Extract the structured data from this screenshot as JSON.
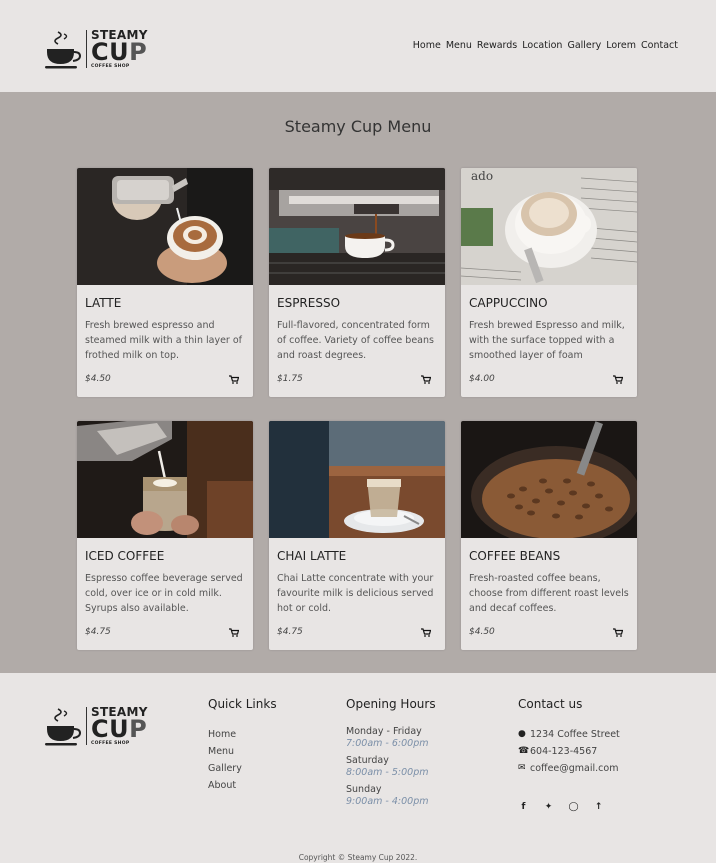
{
  "header": {
    "logo": {
      "top": "STEAMY",
      "mid_a": "CU",
      "mid_b": "P",
      "sub": "COFFEE SHOP"
    },
    "nav": [
      "Home",
      "Menu",
      "Rewards",
      "Location",
      "Gallery",
      "Lorem",
      "Contact"
    ]
  },
  "main": {
    "title": "Steamy Cup Menu",
    "items": [
      {
        "name": "LATTE",
        "desc": "Fresh brewed espresso and steamed milk with a thin layer of frothed milk on top.",
        "price": "$4.50"
      },
      {
        "name": "ESPRESSO",
        "desc": "Full-flavored, concentrated form of coffee. Variety of coffee beans and roast degrees.",
        "price": "$1.75"
      },
      {
        "name": "CAPPUCCINO",
        "desc": "Fresh brewed Espresso and milk, with the surface topped with a smoothed layer of foam",
        "price": "$4.00"
      },
      {
        "name": "ICED COFFEE",
        "desc": "Espresso coffee beverage served cold, over ice or in cold milk. Syrups also available.",
        "price": "$4.75"
      },
      {
        "name": "CHAI LATTE",
        "desc": "Chai Latte concentrate with your favourite milk is delicious served hot or cold.",
        "price": "$4.75"
      },
      {
        "name": "COFFEE BEANS",
        "desc": "Fresh-roasted coffee beans, choose from different roast levels and decaf coffees.",
        "price": "$4.50"
      }
    ]
  },
  "footer": {
    "quick_links": {
      "title": "Quick Links",
      "links": [
        "Home",
        "Menu",
        "Gallery",
        "About"
      ]
    },
    "hours": {
      "title": "Opening Hours",
      "rows": [
        {
          "day": "Monday - Friday",
          "time": "7:00am - 6:00pm"
        },
        {
          "day": "Saturday",
          "time": "8:00am - 5:00pm"
        },
        {
          "day": "Sunday",
          "time": "9:00am - 4:00pm"
        }
      ]
    },
    "contact": {
      "title": "Contact us",
      "address": "1234 Coffee Street",
      "phone": "604-123-4567",
      "email": "coffee@gmail.com"
    },
    "socials": [
      "facebook-icon",
      "twitter-icon",
      "instagram-icon",
      "arrow-up-icon"
    ],
    "copyright": "Copyright © Steamy Cup 2022."
  },
  "colors": {
    "bg": "#e8e5e4",
    "main_bg": "#b1aba8",
    "hours_time": "#7b8fa8"
  }
}
